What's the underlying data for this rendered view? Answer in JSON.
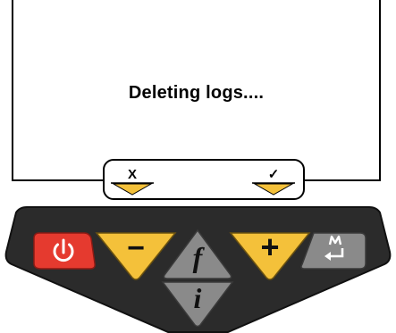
{
  "screen": {
    "message": "Deleting logs....",
    "softkeys": {
      "left_label": "X",
      "right_label": "✓"
    }
  },
  "keypad": {
    "power_icon": "power-icon",
    "minus_glyph": "−",
    "function_glyph": "f",
    "plus_glyph": "+",
    "info_glyph": "i",
    "memory_enter_icon": "memory-enter-icon"
  },
  "colors": {
    "panel": "#2b2b2b",
    "power_key": "#e53a2f",
    "yellow_key": "#f4c13a",
    "gray_key": "#8a8a8a",
    "softkey_arrow": "#f4c13a"
  }
}
